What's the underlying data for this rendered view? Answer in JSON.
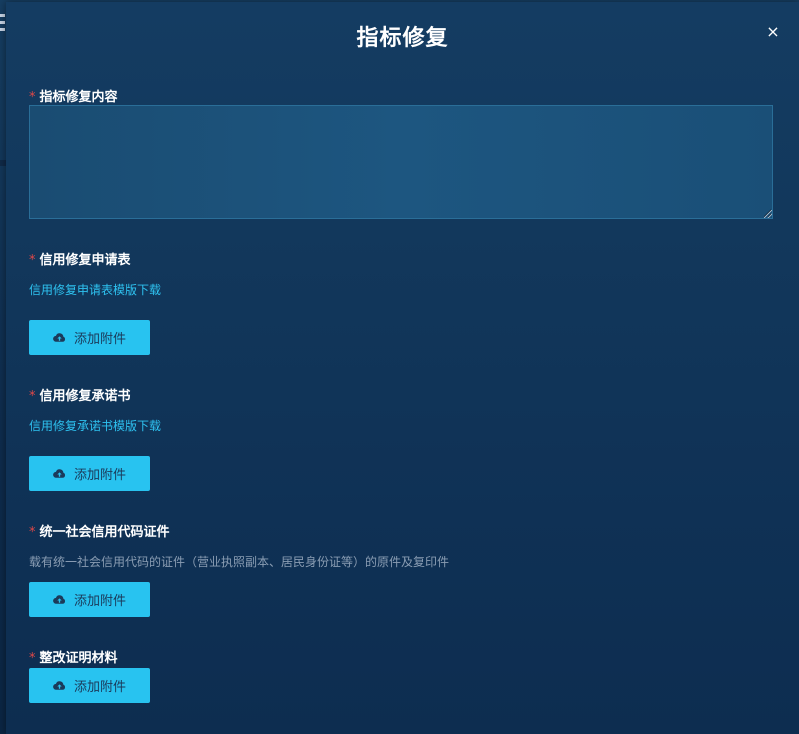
{
  "dialog": {
    "title": "指标修复",
    "close_symbol": "×"
  },
  "fields": {
    "repair_content": {
      "required_mark": "*",
      "label": "指标修复内容",
      "value": "",
      "placeholder": ""
    },
    "application_form": {
      "required_mark": "*",
      "label": "信用修复申请表",
      "template_link": "信用修复申请表模版下载",
      "button_label": "添加附件"
    },
    "commitment_letter": {
      "required_mark": "*",
      "label": "信用修复承诺书",
      "template_link": "信用修复承诺书模版下载",
      "button_label": "添加附件"
    },
    "credit_code_certificate": {
      "required_mark": "*",
      "label": "统一社会信用代码证件",
      "hint": "载有统一社会信用代码的证件（营业执照副本、居民身份证等）的原件及复印件",
      "button_label": "添加附件"
    },
    "rectification_proof": {
      "required_mark": "*",
      "label": "整改证明材料",
      "button_label": "添加附件"
    }
  },
  "icons": {
    "upload": "cloud-upload-icon",
    "close": "close-icon",
    "menu": "hamburger-menu-icon"
  },
  "colors": {
    "accent": "#28c3f0",
    "link": "#2ec2f0",
    "required": "#e04848"
  }
}
